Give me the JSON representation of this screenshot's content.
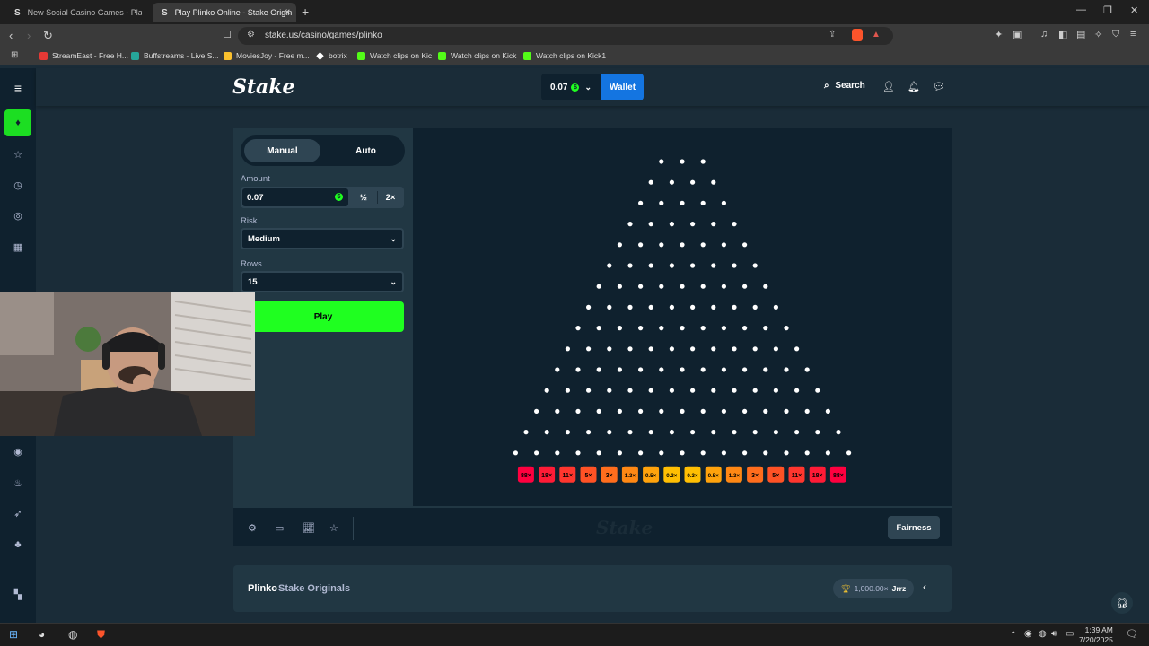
{
  "browser": {
    "tabs": [
      {
        "title": "New Social Casino Games - Play Free",
        "favicon": "S",
        "active": false
      },
      {
        "title": "Play Plinko Online - Stake Origin",
        "favicon": "S",
        "active": true
      }
    ],
    "new_tab": "+",
    "url": "stake.us/casino/games/plinko",
    "bookmarks": [
      {
        "label": "StreamEast - Free H...",
        "color": "#e53935"
      },
      {
        "label": "Buffstreams - Live S...",
        "color": "#26a69a"
      },
      {
        "label": "MoviesJoy - Free m...",
        "color": "#fbc02d"
      },
      {
        "label": "botrix",
        "color": "#ffffff"
      },
      {
        "label": "Watch clips on Kic",
        "color": "#53fc18"
      },
      {
        "label": "Watch clips on Kick",
        "color": "#53fc18"
      },
      {
        "label": "Watch clips on Kick1",
        "color": "#53fc18"
      }
    ]
  },
  "site": {
    "logo": "Stake",
    "balance": "0.07",
    "coin_glyph": "$",
    "wallet_label": "Wallet",
    "search_label": "Search"
  },
  "controls": {
    "mode_manual": "Manual",
    "mode_auto": "Auto",
    "amount_label": "Amount",
    "amount_value": "0.07",
    "half_label": "½",
    "double_label": "2×",
    "risk_label": "Risk",
    "risk_value": "Medium",
    "rows_label": "Rows",
    "rows_value": "15",
    "play_label": "Play"
  },
  "board": {
    "rows": 15,
    "first_row_pegs": 3,
    "multipliers": [
      "88×",
      "18×",
      "11×",
      "5×",
      "3×",
      "1.3×",
      "0.5×",
      "0.3×",
      "0.3×",
      "0.5×",
      "1.3×",
      "3×",
      "5×",
      "11×",
      "18×",
      "88×"
    ],
    "bucket_colors": [
      "#ff003f",
      "#ff1b36",
      "#ff362e",
      "#ff5225",
      "#ff6d1d",
      "#ff8814",
      "#ffa30c",
      "#ffbf03",
      "#ffbf03",
      "#ffa30c",
      "#ff8814",
      "#ff6d1d",
      "#ff5225",
      "#ff362e",
      "#ff1b36",
      "#ff003f"
    ],
    "peg_color": "#ffffff"
  },
  "footer": {
    "watermark": "Stake",
    "fairness_label": "Fairness"
  },
  "info": {
    "game_title": "Plinko",
    "game_provider": "Stake Originals",
    "top_win": "1,000.00×",
    "top_winner": "Jrrz"
  },
  "taskbar": {
    "time": "1:39 AM",
    "date": "7/20/2025"
  },
  "colors": {
    "accent_green": "#1fff20",
    "wallet_blue": "#1475e1",
    "bg": "#1a2c38",
    "panel": "#213743"
  }
}
